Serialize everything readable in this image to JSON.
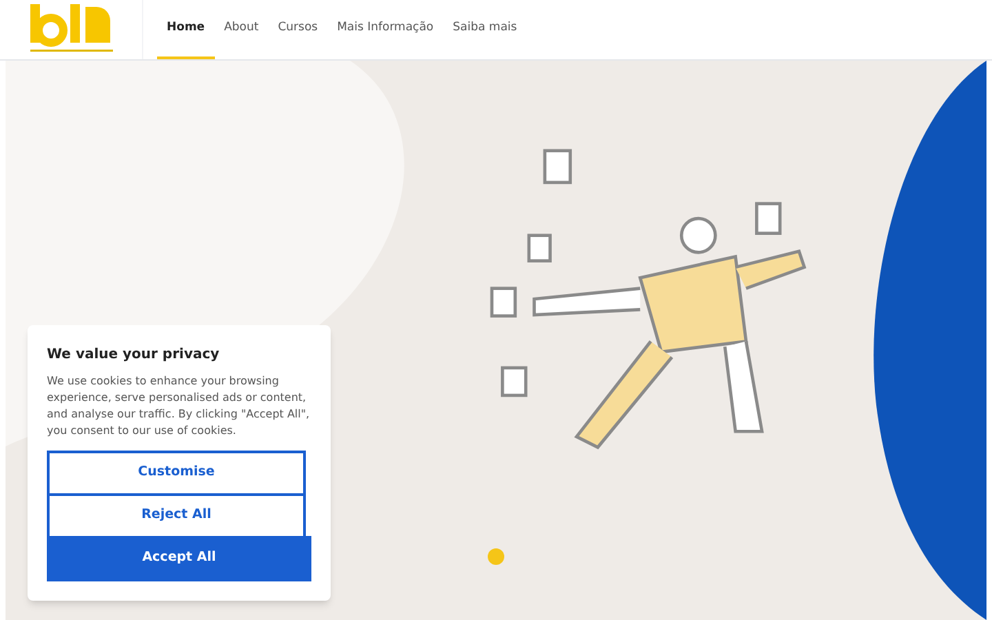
{
  "nav": {
    "items": [
      {
        "label": "Home",
        "selected": true
      },
      {
        "label": "About",
        "selected": false
      },
      {
        "label": "Cursos",
        "selected": false
      },
      {
        "label": "Mais Informação",
        "selected": false
      },
      {
        "label": "Saiba mais",
        "selected": false
      }
    ]
  },
  "cookie_banner": {
    "title": "We value your privacy",
    "text": "We use cookies to enhance your browsing experience, serve personalised ads or content, and analyse our traffic. By clicking \"Accept All\", you consent to our use of cookies.",
    "buttons": [
      {
        "label": "Customise",
        "kind": "outline"
      },
      {
        "label": "Reject All",
        "kind": "outline"
      },
      {
        "label": "Accept All",
        "kind": "primary"
      }
    ]
  }
}
